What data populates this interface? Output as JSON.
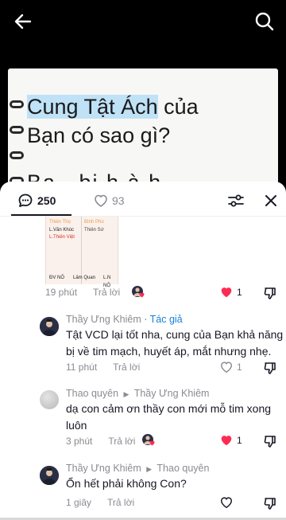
{
  "video": {
    "title_line1_highlight": "Cung Tật Ách",
    "title_line1_rest": " của",
    "title_line2": "Bạn có sao gì?",
    "title_line3_partial": "Ba...bi.h.à.h..."
  },
  "sheet": {
    "comment_count": "250",
    "like_count": "93"
  },
  "thumbnail": {
    "cell1": "Thiên Thọ",
    "cell2": "Bình Phù",
    "cell3": "L.Văn Khúc",
    "cell4": "Thiên Sứ",
    "cell5": "L.Thiên Việt",
    "cell6": "ĐV NÔ",
    "cell7": "Lâm Quan",
    "cell8": "L.N NÔ"
  },
  "comments": [
    {
      "time": "19 phút",
      "reply_label": "Trả lời",
      "likes": "1",
      "liked": true
    },
    {
      "name": "Thầy Ưng Khiêm",
      "author_tag": " · Tác giả",
      "text": "Tật VCD lại tốt nha, cung của Bạn khả năng bị về tim mạch, huyết áp, mắt nhưng nhẹ.",
      "time": "11 phút",
      "reply_label": "Trả lời",
      "likes": "1",
      "liked": false
    },
    {
      "name": "Thao quyên",
      "reply_to": "Thầy Ưng Khiêm",
      "text": "dạ con cảm ơn thầy con mới mỗ tim xong luôn",
      "time": "3 phút",
      "reply_label": "Trả lời",
      "likes": "1",
      "liked": true
    },
    {
      "name": "Thầy Ưng Khiêm",
      "reply_to": "Thao quyên",
      "text": "Ổn hết phải không Con?",
      "time": "1 giây",
      "reply_label": "Trả lời",
      "likes": "",
      "liked": false
    }
  ],
  "colors": {
    "like_red": "#fe2c55",
    "author_blue": "#1a7fd6",
    "highlight": "#bfe2f7"
  },
  "icons": [
    "back-arrow-icon",
    "search-icon",
    "comment-icon",
    "heart-icon",
    "filter-icon",
    "close-icon",
    "thumb-down-icon"
  ]
}
